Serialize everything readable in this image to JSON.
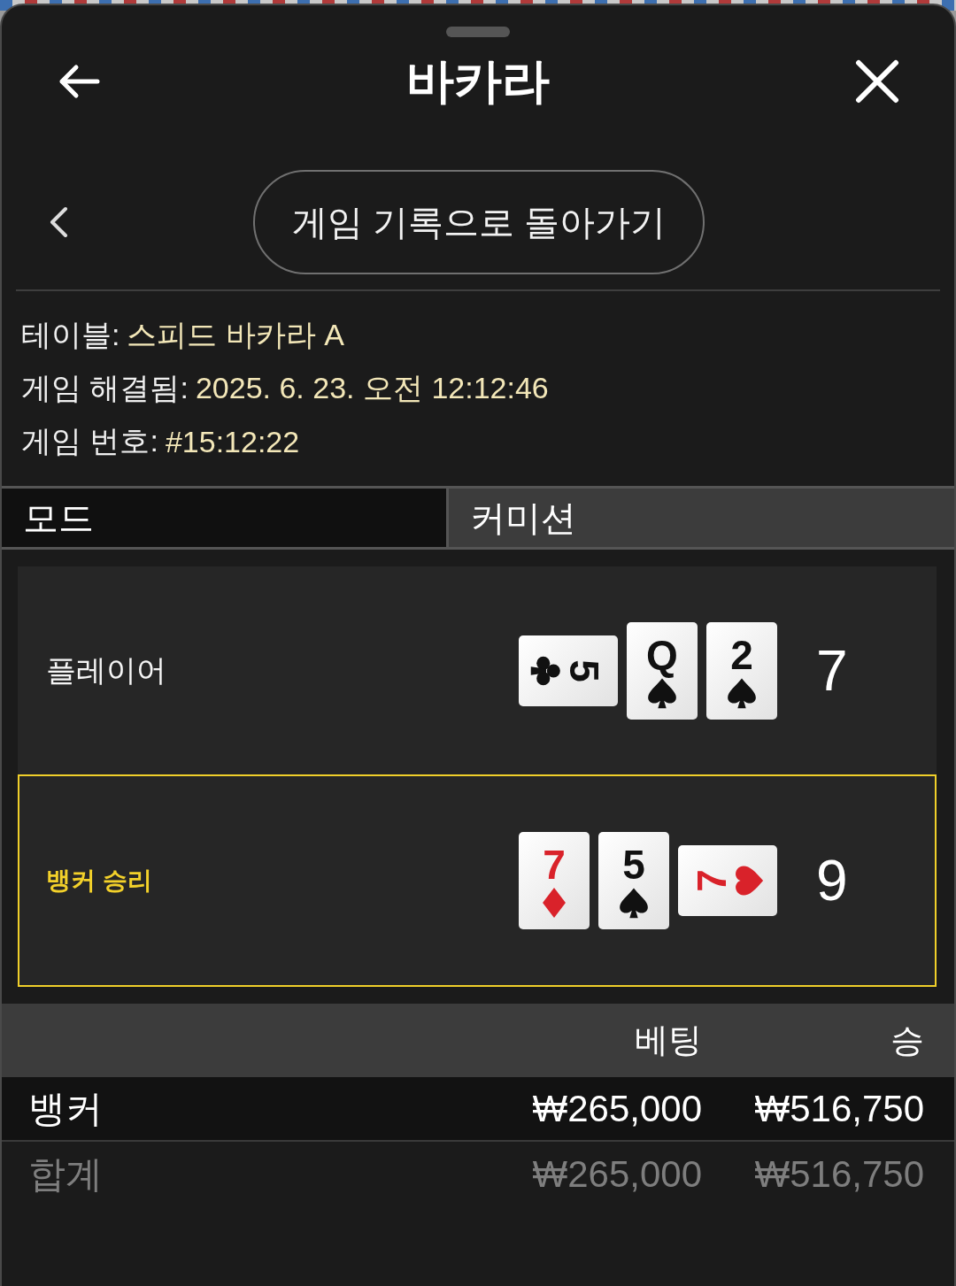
{
  "sheet": {
    "title": "바카라"
  },
  "back_link": {
    "label": "게임 기록으로 돌아가기"
  },
  "details": [
    {
      "label": "테이블:",
      "value": "스피드 바카라 A"
    },
    {
      "label": "게임 해결됨:",
      "value": "2025. 6. 23. 오전 12:12:46"
    },
    {
      "label": "게임 번호:",
      "value": "#15:12:22"
    }
  ],
  "tabs": [
    {
      "label": "모드",
      "selected": true
    },
    {
      "label": "커미션",
      "selected": false
    }
  ],
  "hands": [
    {
      "label": "플레이어",
      "winner": false,
      "score": "7",
      "cards": [
        {
          "rank": "5",
          "kind": "clubs",
          "rotated_cw": true,
          "rotated_ccw": false
        },
        {
          "rank": "Q",
          "kind": "spades",
          "rotated_cw": false,
          "rotated_ccw": false
        },
        {
          "rank": "2",
          "kind": "spades",
          "rotated_cw": false,
          "rotated_ccw": false
        }
      ]
    },
    {
      "label": "뱅커 승리",
      "winner": true,
      "score": "9",
      "cards": [
        {
          "rank": "7",
          "kind": "diamonds",
          "rotated_cw": false,
          "rotated_ccw": false
        },
        {
          "rank": "5",
          "kind": "spades",
          "rotated_cw": false,
          "rotated_ccw": false
        },
        {
          "rank": "7",
          "kind": "hearts",
          "rotated_cw": false,
          "rotated_ccw": true
        }
      ]
    }
  ],
  "bets": {
    "columns": [
      "베팅",
      "승"
    ],
    "rows": [
      {
        "label": "뱅커",
        "kind": "entry",
        "values": [
          "₩265,000",
          "₩516,750"
        ]
      },
      {
        "label": "합계",
        "kind": "total",
        "values": [
          "₩265,000",
          "₩516,750"
        ]
      }
    ]
  }
}
